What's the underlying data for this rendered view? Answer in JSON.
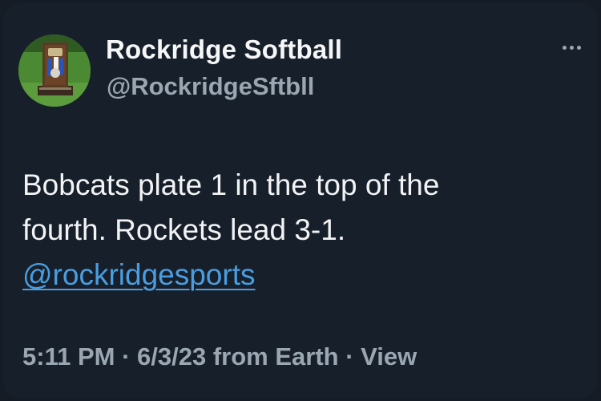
{
  "profile": {
    "display_name": "Rockridge Softball",
    "handle": "@RockridgeSftbll",
    "avatar_icon": "trophy-avatar"
  },
  "menu": {
    "more_icon": "more-horizontal-icon"
  },
  "tweet": {
    "line1": "Bobcats plate 1 in the top of the",
    "line2": "fourth. Rockets lead 3-1.",
    "mention": "@rockridgesports"
  },
  "meta": {
    "time": "5:11 PM",
    "separator1": " · ",
    "date": "6/3/23",
    "source": " from Earth",
    "separator2": " · ",
    "view_label": "View"
  },
  "colors": {
    "background": "#17202a",
    "primary_text": "#f2f3f5",
    "secondary_text": "#9aa6b2",
    "link": "#4a9de0"
  }
}
